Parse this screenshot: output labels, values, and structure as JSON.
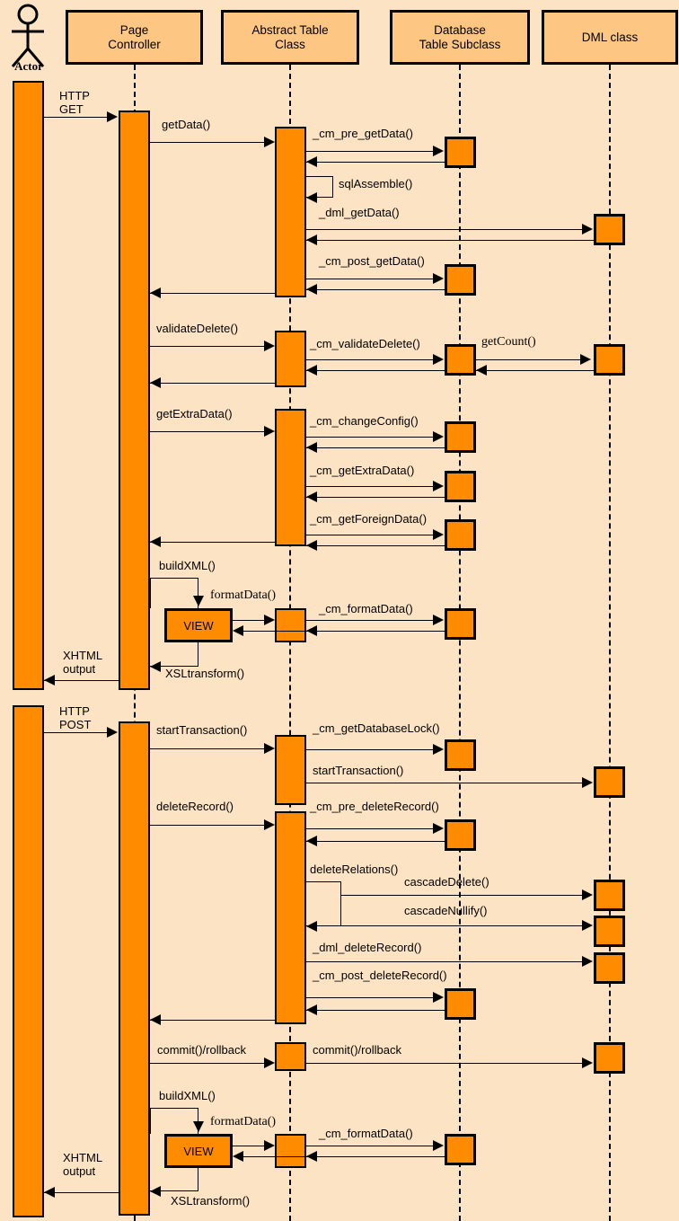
{
  "diagram": {
    "type": "uml-sequence-diagram",
    "background_color": "#fce3c3",
    "activation_color": "#ff8c00",
    "participant_color": "#fdc683",
    "border_color": "#000000"
  },
  "participants": [
    {
      "id": "actor",
      "label": "Actor",
      "kind": "actor"
    },
    {
      "id": "page",
      "label": "Page\nController",
      "kind": "box"
    },
    {
      "id": "abstract",
      "label": "Abstract Table\nClass",
      "kind": "box"
    },
    {
      "id": "dbsub",
      "label": "Database\nTable Subclass",
      "kind": "box"
    },
    {
      "id": "dml",
      "label": "DML class",
      "kind": "box"
    }
  ],
  "objects": {
    "view_label": "VIEW"
  },
  "messages": [
    {
      "id": "m01",
      "label": "HTTP\nGET",
      "from": "actor",
      "to": "page"
    },
    {
      "id": "m02",
      "label": "getData()",
      "from": "page",
      "to": "abstract"
    },
    {
      "id": "m03",
      "label": "_cm_pre_getData()",
      "from": "abstract",
      "to": "dbsub"
    },
    {
      "id": "m04",
      "label": "sqlAssemble()",
      "from": "abstract",
      "to": "abstract"
    },
    {
      "id": "m05",
      "label": "_dml_getData()",
      "from": "abstract",
      "to": "dml"
    },
    {
      "id": "m06",
      "label": "_cm_post_getData()",
      "from": "abstract",
      "to": "dbsub"
    },
    {
      "id": "m07",
      "label": "validateDelete()",
      "from": "page",
      "to": "abstract"
    },
    {
      "id": "m08",
      "label": "_cm_validateDelete()",
      "from": "abstract",
      "to": "dbsub"
    },
    {
      "id": "m09",
      "label": "getCount()",
      "from": "dbsub",
      "to": "dml"
    },
    {
      "id": "m10",
      "label": "getExtraData()",
      "from": "page",
      "to": "abstract"
    },
    {
      "id": "m11",
      "label": "_cm_changeConfig()",
      "from": "abstract",
      "to": "dbsub"
    },
    {
      "id": "m12",
      "label": "_cm_getExtraData()",
      "from": "abstract",
      "to": "dbsub"
    },
    {
      "id": "m13",
      "label": "_cm_getForeignData()",
      "from": "abstract",
      "to": "dbsub"
    },
    {
      "id": "m14",
      "label": "buildXML()",
      "from": "page",
      "to": "view"
    },
    {
      "id": "m15",
      "label": "formatData()",
      "from": "view",
      "to": "abstract"
    },
    {
      "id": "m16",
      "label": "_cm_formatData()",
      "from": "abstract",
      "to": "dbsub"
    },
    {
      "id": "m17",
      "label": "XSLtransform()",
      "from": "view",
      "to": "page"
    },
    {
      "id": "m18",
      "label": "XHTML\noutput",
      "from": "page",
      "to": "actor"
    },
    {
      "id": "m19",
      "label": "HTTP\nPOST",
      "from": "actor",
      "to": "page"
    },
    {
      "id": "m20",
      "label": "startTransaction()",
      "from": "page",
      "to": "abstract"
    },
    {
      "id": "m21",
      "label": "_cm_getDatabaseLock()",
      "from": "abstract",
      "to": "dbsub"
    },
    {
      "id": "m22",
      "label": "startTransaction()",
      "from": "abstract",
      "to": "dml"
    },
    {
      "id": "m23",
      "label": "deleteRecord()",
      "from": "page",
      "to": "abstract"
    },
    {
      "id": "m24",
      "label": "_cm_pre_deleteRecord()",
      "from": "abstract",
      "to": "dbsub"
    },
    {
      "id": "m25",
      "label": "deleteRelations()",
      "from": "abstract",
      "to": "abstract"
    },
    {
      "id": "m26",
      "label": "cascadeDelete()",
      "from": "abstract",
      "to": "dml"
    },
    {
      "id": "m27",
      "label": "cascadeNullify()",
      "from": "abstract",
      "to": "dml"
    },
    {
      "id": "m28",
      "label": "_dml_deleteRecord()",
      "from": "abstract",
      "to": "dml"
    },
    {
      "id": "m29",
      "label": "_cm_post_deleteRecord()",
      "from": "abstract",
      "to": "dbsub"
    },
    {
      "id": "m30",
      "label": "commit()/rollback",
      "from": "page",
      "to": "abstract"
    },
    {
      "id": "m31",
      "label": "commit()/rollback",
      "from": "abstract",
      "to": "dml"
    },
    {
      "id": "m32",
      "label": "buildXML()",
      "from": "page",
      "to": "view"
    },
    {
      "id": "m33",
      "label": "formatData()",
      "from": "view",
      "to": "abstract"
    },
    {
      "id": "m34",
      "label": "_cm_formatData()",
      "from": "abstract",
      "to": "dbsub"
    },
    {
      "id": "m35",
      "label": "XHTML\noutput",
      "from": "page",
      "to": "actor"
    },
    {
      "id": "m36",
      "label": "XSLtransform()",
      "from": "view",
      "to": "page"
    }
  ]
}
